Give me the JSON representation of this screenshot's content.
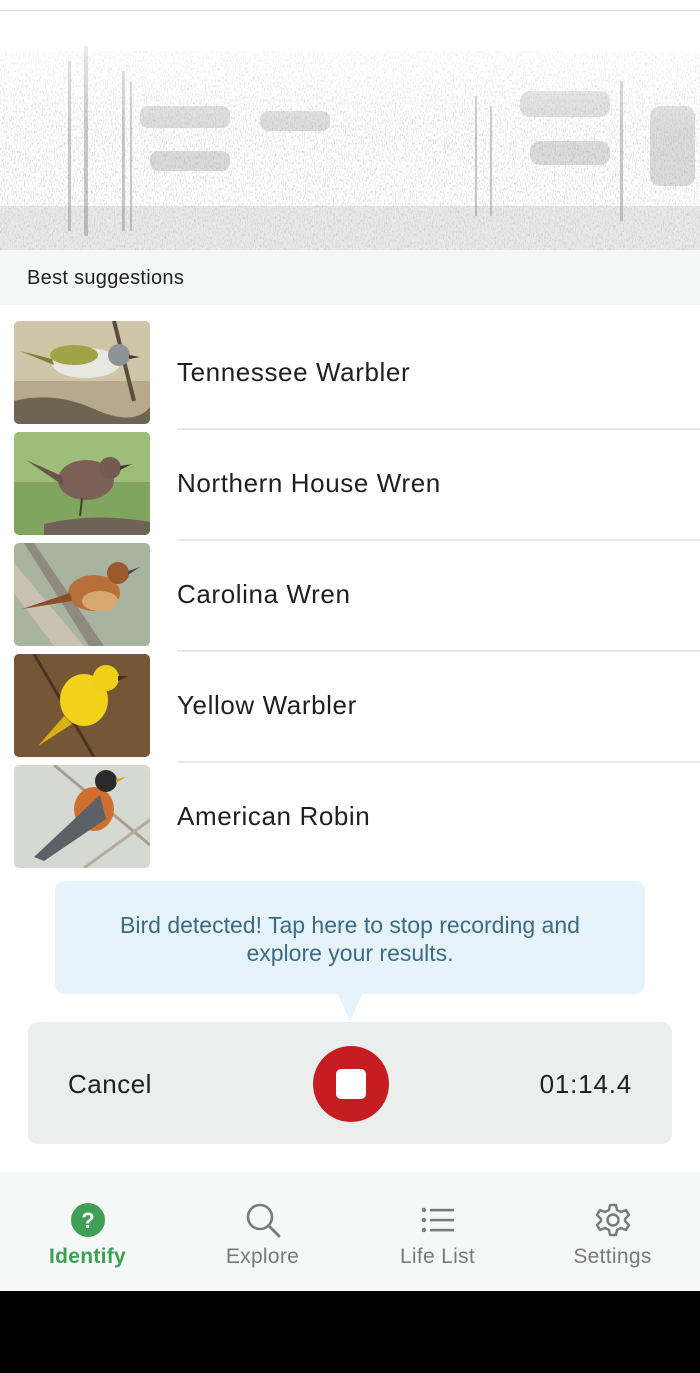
{
  "spectrogram": {
    "icon": "spectrogram-image"
  },
  "suggestions": {
    "header": "Best suggestions",
    "items": [
      {
        "name": "Tennessee Warbler"
      },
      {
        "name": "Northern House Wren"
      },
      {
        "name": "Carolina Wren"
      },
      {
        "name": "Yellow Warbler"
      },
      {
        "name": "American Robin"
      }
    ]
  },
  "tooltip": {
    "text": "Bird detected! Tap here to stop recording and explore your results."
  },
  "recorder": {
    "cancel_label": "Cancel",
    "timer": "01:14.4",
    "stop_color": "#c51d22"
  },
  "nav": {
    "items": [
      {
        "label": "Identify",
        "icon": "question-circle-icon",
        "active": true
      },
      {
        "label": "Explore",
        "icon": "search-icon",
        "active": false
      },
      {
        "label": "Life List",
        "icon": "list-icon",
        "active": false
      },
      {
        "label": "Settings",
        "icon": "gear-icon",
        "active": false
      }
    ],
    "active_color": "#3f9f54"
  }
}
